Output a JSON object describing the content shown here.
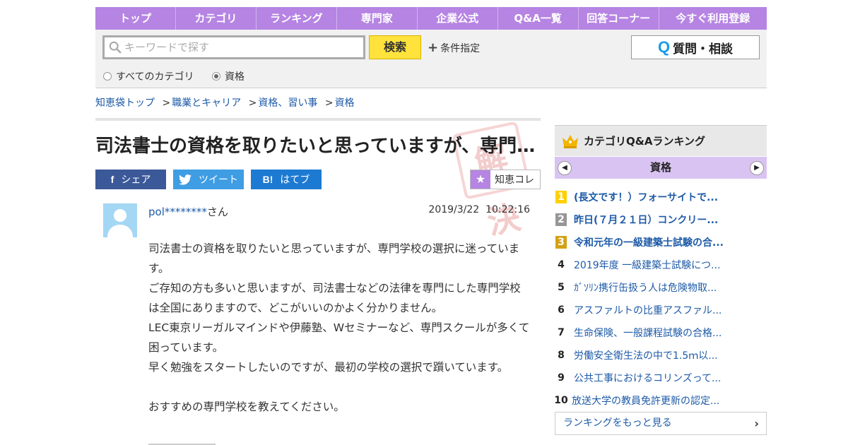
{
  "nav": {
    "items": [
      "トップ",
      "カテゴリ",
      "ランキング",
      "専門家",
      "企業公式",
      "Q&A一覧",
      "回答コーナー",
      "今すぐ利用登録"
    ]
  },
  "search": {
    "placeholder": "キーワードで探す",
    "button_label": "検索",
    "condition_label": "条件指定",
    "ask_label": "質問・相談",
    "ask_icon": "Q",
    "radio_all": "すべてのカテゴリ",
    "radio_cat": "資格"
  },
  "breadcrumb": {
    "items": [
      "知恵袋トップ",
      "職業とキャリア",
      "資格、習い事",
      "資格"
    ],
    "separator": ">"
  },
  "question": {
    "title": "司法書士の資格を取りたいと思っていますが、専門学校の選択に迷っています。",
    "stamp": "解決",
    "user": "pol********",
    "user_suffix": "さん",
    "date": "2019/3/22",
    "time": "10:22:16",
    "body": [
      "司法書士の資格を取りたいと思っていますが、専門学校の選択に迷っています。",
      "ご存知の方も多いと思いますが、司法書士などの法律を専門にした専門学校は全国にありますので、どこがいいのかよく分かりません。",
      "LEC東京リーガルマインドや伊藤塾、Wセミナーなど、専門スクールが多くて困っています。",
      "早く勉強をスタートしたいのですが、最初の学校の選択で躓いています。",
      "",
      "おすすめの専門学校を教えてください。"
    ]
  },
  "share": {
    "facebook": "シェア",
    "facebook_icon": "f",
    "twitter": "ツイート",
    "hatena": "はてブ",
    "hatena_icon": "B!",
    "chie_label": "知恵コレ",
    "chie_icon": "★"
  },
  "ranking": {
    "title": "カテゴリQ&Aランキング",
    "category": "資格",
    "prev_icon": "◀",
    "next_icon": "▶",
    "items": [
      {
        "rank": "1",
        "text": "(長文です！）フォーサイトで..."
      },
      {
        "rank": "2",
        "text": "昨日(７月２１日）コンクリー..."
      },
      {
        "rank": "3",
        "text": "令和元年の一級建築士試験の合..."
      },
      {
        "rank": "4",
        "text": "2019年度 一級建築士試験につ..."
      },
      {
        "rank": "5",
        "text": "ｶﾞｿﾘﾝ携行缶扱う人は危険物取..."
      },
      {
        "rank": "6",
        "text": "アスファルトの比重アスファル..."
      },
      {
        "rank": "7",
        "text": "生命保険、一般課程試験の合格..."
      },
      {
        "rank": "8",
        "text": "労働安全衛生法の中で1.5ｍ以..."
      },
      {
        "rank": "9",
        "text": "公共工事におけるコリンズって..."
      },
      {
        "rank": "10",
        "text": "放送大学の教員免許更新の認定..."
      }
    ],
    "more_label": "ランキングをもっと見る",
    "more_icon": "›"
  },
  "colors": {
    "nav_bg": "#b684e3",
    "search_button": "#ffe23c",
    "link": "#1d5aa7",
    "facebook": "#3b5998",
    "twitter": "#3f9de4",
    "hatena": "#1d7ad2"
  }
}
